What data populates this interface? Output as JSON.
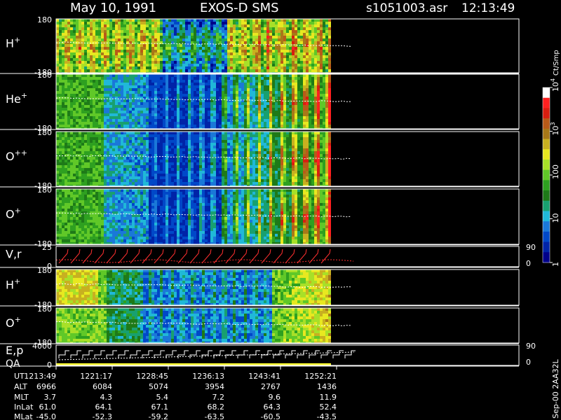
{
  "header": {
    "date": "May 10, 1991",
    "instrument": "EXOS-D SMS",
    "file": "s1051003.asr",
    "time": "12:13:49"
  },
  "colorbar": {
    "unit": "Ct/Smp",
    "ticks": [
      {
        "value": 1,
        "label": "1"
      },
      {
        "value": 10,
        "label": "10"
      },
      {
        "value": 100,
        "label": "100"
      },
      {
        "value": 1000,
        "label": "10",
        "sup": "3"
      },
      {
        "value": 10000,
        "label": "10",
        "sup": "4"
      }
    ],
    "colors": [
      "#00008a",
      "#0024a8",
      "#0048c8",
      "#1a78d8",
      "#20b8d8",
      "#18a070",
      "#1e7a18",
      "#2ea020",
      "#60c828",
      "#a8e028",
      "#e8e820",
      "#c8b020",
      "#a87818",
      "#b85a18",
      "#d81e10",
      "#ff2020",
      "#ffffff"
    ]
  },
  "panels": [
    {
      "id": "h-plus",
      "label": "H",
      "sup": "+",
      "ymax": "180",
      "ymin": "-180"
    },
    {
      "id": "he-plus",
      "label": "He",
      "sup": "+",
      "ymax": "180",
      "ymin": "-180"
    },
    {
      "id": "o-plusplus",
      "label": "O",
      "sup": "++",
      "ymax": "180",
      "ymin": "-180"
    },
    {
      "id": "o-plus",
      "label": "O",
      "sup": "+",
      "ymax": "180",
      "ymin": "-180"
    },
    {
      "id": "vr",
      "label": "V,r",
      "ymax": "25",
      "ymin": "0",
      "rmax": "90",
      "rmin": "0"
    },
    {
      "id": "h-plus-2",
      "label": "H",
      "sup": "+",
      "ymax": "180",
      "ymin": "-180"
    },
    {
      "id": "o-plus-2",
      "label": "O",
      "sup": "+",
      "ymax": "180",
      "ymin": "-180"
    },
    {
      "id": "ep",
      "label": "E,p",
      "label2": "QA",
      "ymax": "4000",
      "ymin": "0",
      "rmax": "90",
      "rmin": "0"
    }
  ],
  "footer_table": {
    "row_labels": [
      "UT",
      "ALT",
      "MLT",
      "InLat",
      "MLat"
    ],
    "columns": [
      {
        "UT": "1213:49",
        "ALT": "6966",
        "MLT": "3.7",
        "InLat": "61.0",
        "MLat": "-45.0"
      },
      {
        "UT": "1221:17",
        "ALT": "6084",
        "MLT": "4.3",
        "InLat": "64.1",
        "MLat": "-52.3"
      },
      {
        "UT": "1228:45",
        "ALT": "5074",
        "MLT": "5.4",
        "InLat": "67.1",
        "MLat": "-59.2"
      },
      {
        "UT": "1236:13",
        "ALT": "3954",
        "MLT": "7.2",
        "InLat": "68.2",
        "MLat": "-63.5"
      },
      {
        "UT": "1243:41",
        "ALT": "2767",
        "MLT": "9.6",
        "InLat": "64.3",
        "MLat": "-60.5"
      },
      {
        "UT": "1252:21",
        "ALT": "1436",
        "MLT": "11.9",
        "InLat": "52.4",
        "MLat": "-43.5"
      }
    ]
  },
  "side_note": "Sep-00  2AA32L",
  "chart_data": {
    "type": "heatmap",
    "title": "May 10, 1991   EXOS-D SMS",
    "x": [
      "1213:49",
      "1221:17",
      "1228:45",
      "1236:13",
      "1243:41",
      "1252:21"
    ],
    "colorbar_range": [
      1,
      10000
    ],
    "colorbar_scale": "log",
    "series": [
      {
        "name": "H+",
        "ylim": [
          -180,
          180
        ]
      },
      {
        "name": "He+",
        "ylim": [
          -180,
          180
        ]
      },
      {
        "name": "O++",
        "ylim": [
          -180,
          180
        ]
      },
      {
        "name": "O+",
        "ylim": [
          -180,
          180
        ]
      },
      {
        "name": "V,r",
        "ylim": [
          0,
          25
        ],
        "y2lim": [
          0,
          90
        ]
      },
      {
        "name": "H+",
        "ylim": [
          -180,
          180
        ]
      },
      {
        "name": "O+",
        "ylim": [
          -180,
          180
        ]
      },
      {
        "name": "E,p",
        "ylim": [
          0,
          4000
        ],
        "y2lim": [
          0,
          90
        ]
      }
    ]
  }
}
